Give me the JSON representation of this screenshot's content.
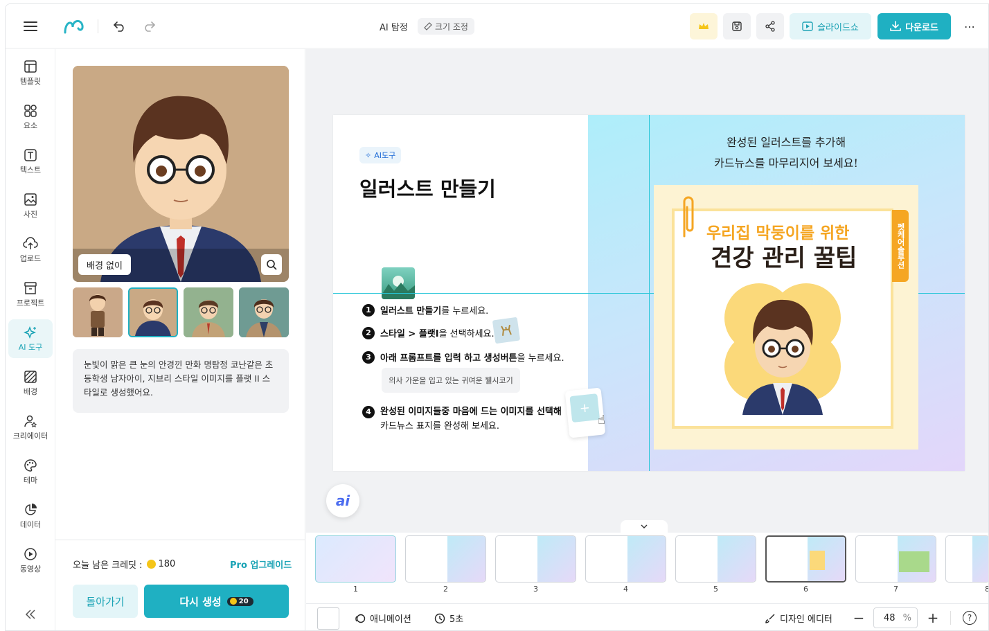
{
  "topbar": {
    "doc_title": "AI 탐정",
    "resize_label": "크기 조정",
    "slideshow_label": "슬라이드쇼",
    "download_label": "다운로드",
    "more_label": "⋯"
  },
  "sidebar": {
    "items": [
      {
        "label": "템플릿"
      },
      {
        "label": "요소"
      },
      {
        "label": "텍스트"
      },
      {
        "label": "사진"
      },
      {
        "label": "업로드"
      },
      {
        "label": "프로젝트"
      },
      {
        "label": "AI 도구"
      },
      {
        "label": "배경"
      },
      {
        "label": "크리에이터"
      },
      {
        "label": "테마"
      },
      {
        "label": "데이터"
      },
      {
        "label": "동영상"
      }
    ]
  },
  "panel": {
    "no_bg_label": "배경 없이",
    "prompt_text": "눈빛이 맑은 큰 눈의 안경낀 만화 명탐정 코난같은 초등학생 남자아이, 지브리 스타일 이미지를 플랫 II 스타일로 생성했어요.",
    "credits_label": "오늘 남은 크레딧 :",
    "credits_value": "180",
    "upgrade_label": "Pro 업그레이드",
    "back_label": "돌아가기",
    "regen_label": "다시 생성",
    "regen_cost": "20"
  },
  "slide": {
    "tag": "AI도구",
    "title": "일러스트 만들기",
    "steps": [
      {
        "num": "1",
        "bold": "일러스트 만들기",
        "rest": "를 누르세요."
      },
      {
        "num": "2",
        "bold": "스타일 > 플랫I",
        "rest": "을 선택하세요."
      },
      {
        "num": "3",
        "bold": "아래 프롬프트를 입력 하고 생성버튼",
        "rest": "을 누르세요."
      },
      {
        "num": "4",
        "bold": "완성된 이미지들중 마음에 드는 이미지를 선택해",
        "rest": "카드뉴스 표지를 완성해 보세요."
      }
    ],
    "prompt_example": "의사 가운을 입고 있는 귀여운 웰시코기",
    "handwriting_line1": "완성된 일러스트를 추가해",
    "handwriting_line2": "카드뉴스를 마무리지어 보세요!",
    "card_subtitle": "우리집 막둥이를 위한",
    "card_title": "견강 관리 꿀팁",
    "card_tab": "펫케어솔루션"
  },
  "thumbnails": [
    "1",
    "2",
    "3",
    "4",
    "5",
    "6",
    "7",
    "8"
  ],
  "bottombar": {
    "animation_label": "애니메이션",
    "duration_label": "5초",
    "design_editor_label": "디자인 에디터",
    "zoom_value": "48",
    "zoom_unit": "%",
    "help_label": "?"
  },
  "colors": {
    "accent": "#1fb0c2",
    "accent_light": "#e6f6f8",
    "card_orange": "#f5a623",
    "card_yellow": "#fbd97a"
  }
}
